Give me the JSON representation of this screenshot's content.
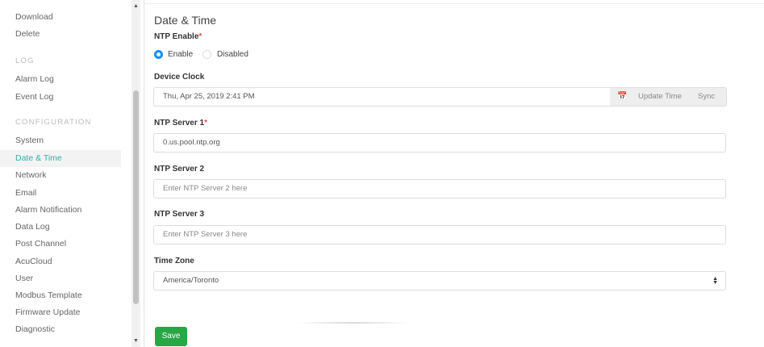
{
  "sidebar": {
    "items_top": [
      {
        "label": "Download"
      },
      {
        "label": "Delete"
      }
    ],
    "section_log": "LOG",
    "log_items": [
      {
        "label": "Alarm Log"
      },
      {
        "label": "Event Log"
      }
    ],
    "section_config": "CONFIGURATION",
    "config_items": [
      {
        "label": "System"
      },
      {
        "label": "Date & Time",
        "active": true
      },
      {
        "label": "Network"
      },
      {
        "label": "Email"
      },
      {
        "label": "Alarm Notification"
      },
      {
        "label": "Data Log"
      },
      {
        "label": "Post Channel"
      },
      {
        "label": "AcuCloud"
      },
      {
        "label": "User"
      },
      {
        "label": "Modbus Template"
      },
      {
        "label": "Firmware Update"
      },
      {
        "label": "Diagnostic"
      }
    ]
  },
  "main": {
    "title": "Date & Time",
    "ntp_enable": {
      "label": "NTP Enable",
      "required_mark": "*",
      "options": [
        "Enable",
        "Disabled"
      ],
      "selected": "Enable"
    },
    "device_clock": {
      "label": "Device Clock",
      "value": "Thu, Apr 25, 2019 2:41 PM",
      "update_label": "Update Time",
      "sync_label": "Sync"
    },
    "ntp_server_1": {
      "label": "NTP Server 1",
      "required_mark": "*",
      "value": "0.us.pool.ntp.org"
    },
    "ntp_server_2": {
      "label": "NTP Server 2",
      "placeholder": "Enter NTP Server 2 here"
    },
    "ntp_server_3": {
      "label": "NTP Server 3",
      "placeholder": "Enter NTP Server 3 here"
    },
    "time_zone": {
      "label": "Time Zone",
      "value": "America/Toronto"
    },
    "save_label": "Save"
  },
  "colors": {
    "accent_teal": "#2bb0a8",
    "radio_blue": "#1a8cff",
    "save_green": "#28a745",
    "required_red": "#d9534f"
  },
  "icons": {
    "calendar": "calendar-icon",
    "select_arrows": "select-arrows-icon",
    "scroll_up": "scroll-up-icon",
    "scroll_down": "scroll-down-icon"
  }
}
